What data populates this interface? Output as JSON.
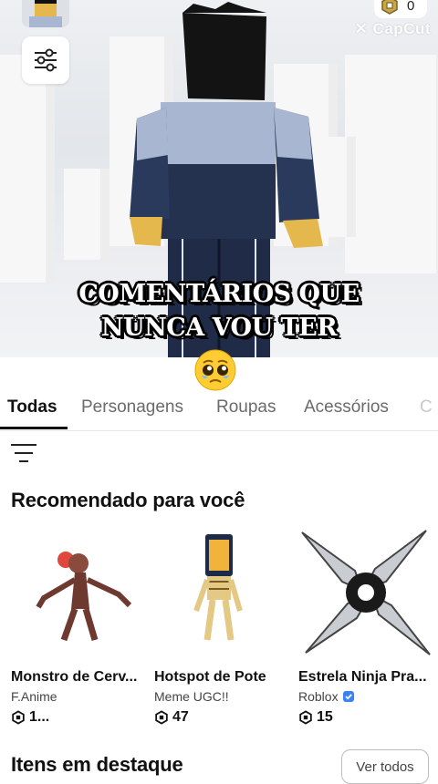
{
  "header": {
    "robux_balance": "0",
    "watermark": "CapCut"
  },
  "caption": {
    "line1": "COMENTÁRIOS QUE",
    "line2": "NUNCA VOU TER"
  },
  "tabs": [
    {
      "label": "Todas",
      "active": true
    },
    {
      "label": "Personagens",
      "active": false
    },
    {
      "label": "Roupas",
      "active": false
    },
    {
      "label": "Acessórios",
      "active": false
    },
    {
      "label": "C",
      "active": false
    }
  ],
  "recommended": {
    "title": "Recomendado para você",
    "items": [
      {
        "name": "Monstro de Cerv...",
        "creator": "F.Anime",
        "verified": false,
        "price": "1..."
      },
      {
        "name": "Hotspot de Pote",
        "creator": "Meme UGC!!",
        "verified": false,
        "price": "47"
      },
      {
        "name": "Estrela Ninja Pra...",
        "creator": "Roblox",
        "verified": true,
        "price": "15"
      }
    ]
  },
  "featured": {
    "title": "Itens em destaque",
    "view_all": "Ver todos"
  },
  "icons": {
    "filter": "sliders-icon",
    "sort": "sort-lines-icon",
    "robux": "robux-icon",
    "verified": "verified-badge-icon",
    "emoji": "pleading-face-emoji"
  },
  "colors": {
    "verified_blue": "#3b82f6",
    "text_primary": "#111111",
    "text_secondary": "#6b6b6b"
  }
}
